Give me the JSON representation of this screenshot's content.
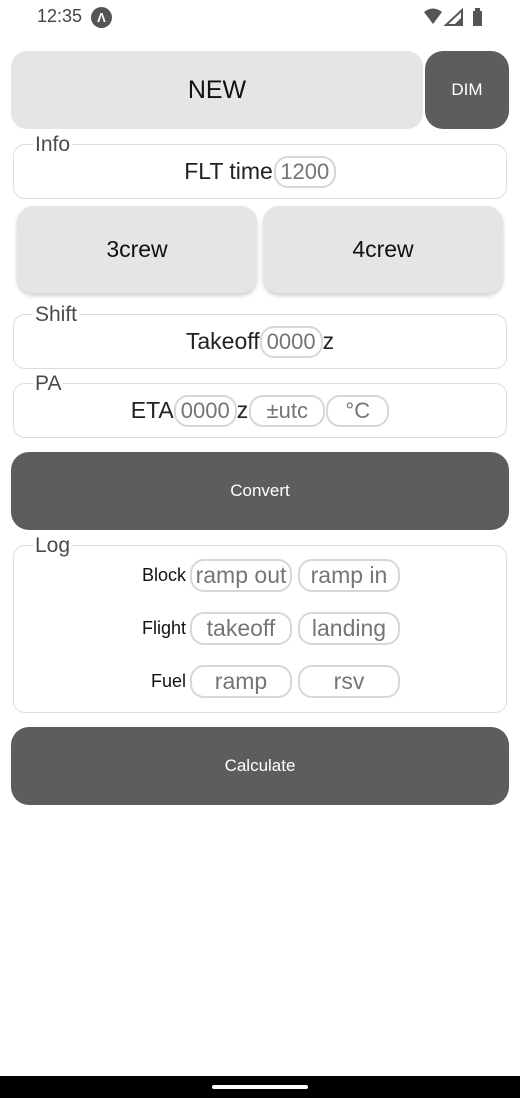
{
  "status_bar": {
    "time": "12:35",
    "app_icon_glyph": "Λ",
    "icons": [
      "wifi-icon",
      "signal-icon",
      "battery-icon"
    ]
  },
  "top": {
    "new_label": "NEW",
    "dim_label": "DIM"
  },
  "info": {
    "legend": "Info",
    "flt_time_label": "FLT time",
    "flt_time_placeholder": "1200",
    "crew_buttons": [
      "3crew",
      "4crew"
    ]
  },
  "shift": {
    "legend": "Shift",
    "takeoff_label": "Takeoff",
    "takeoff_placeholder": "0000",
    "suffix": "z"
  },
  "pa": {
    "legend": "PA",
    "eta_label": "ETA",
    "eta_placeholder": "0000",
    "suffix": "z",
    "utc_placeholder": "±utc",
    "temp_placeholder": "°C"
  },
  "convert_label": "Convert",
  "log": {
    "legend": "Log",
    "rows": [
      {
        "label": "Block",
        "fields": [
          "ramp out",
          "ramp in"
        ]
      },
      {
        "label": "Flight",
        "fields": [
          "takeoff",
          "landing"
        ]
      },
      {
        "label": "Fuel",
        "fields": [
          "ramp",
          "rsv"
        ]
      }
    ]
  },
  "calculate_label": "Calculate",
  "colors": {
    "dark_button": "#5e5c5c",
    "light_button": "#e6e5e3",
    "border": "#d7d7d7"
  }
}
